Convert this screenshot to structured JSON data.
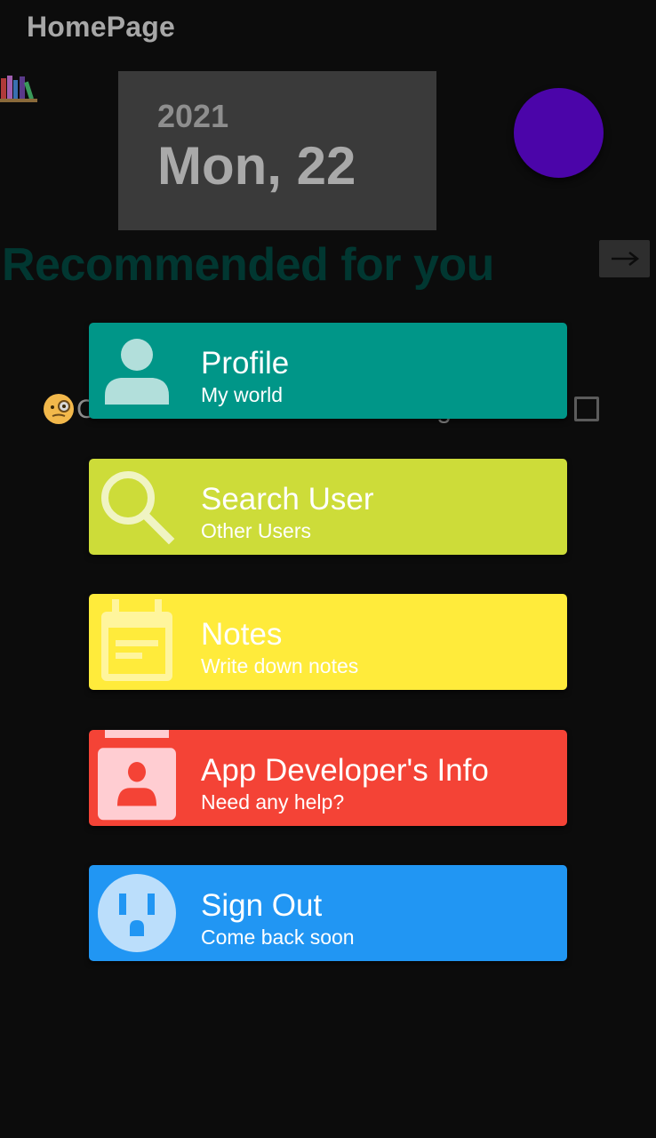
{
  "header": {
    "title": "HomePage"
  },
  "date_card": {
    "year": "2021",
    "day": "Mon, 22"
  },
  "recommended": {
    "title": "Recommended for you",
    "arrow": "→"
  },
  "hidden_row": {
    "text": "Click here to find out the book genres"
  },
  "menu": [
    {
      "label": "Profile",
      "subtitle": "My world",
      "icon": "person-icon",
      "color": "#009688"
    },
    {
      "label": "Search User",
      "subtitle": "Other Users",
      "icon": "search-icon",
      "color": "#cddc39"
    },
    {
      "label": "Notes",
      "subtitle": "Write down notes",
      "icon": "calendar-notes-icon",
      "color": "#ffeb3b"
    },
    {
      "label": "App Developer's Info",
      "subtitle": "Need any help?",
      "icon": "contact-card-icon",
      "color": "#f44336"
    },
    {
      "label": "Sign Out",
      "subtitle": "Come back soon",
      "icon": "power-outlet-icon",
      "color": "#2196f3"
    }
  ],
  "colors": {
    "background": "#0c0c0c",
    "avatar": "#4b05a9",
    "date_card": "#3a3a3a",
    "recommended_title": "#013731"
  }
}
